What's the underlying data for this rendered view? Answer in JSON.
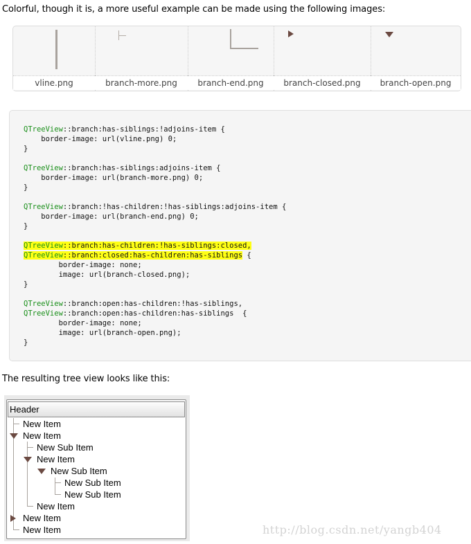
{
  "intro": "Colorful, though it is, a more useful example can be made using the following images:",
  "images": [
    {
      "file": "vline.png",
      "icon": "vertical-line"
    },
    {
      "file": "branch-more.png",
      "icon": "branch-more"
    },
    {
      "file": "branch-end.png",
      "icon": "branch-end"
    },
    {
      "file": "branch-closed.png",
      "icon": "closed-triangle"
    },
    {
      "file": "branch-open.png",
      "icon": "open-triangle"
    }
  ],
  "code": {
    "selector_kw": "QTreeView",
    "blocks": [
      {
        "sel1": "::branch:has-siblings:!adjoins-item",
        "tail1": " {",
        "body": [
          "    border-image: url(vline.png) 0;"
        ],
        "close": "}"
      },
      {
        "sel1": "::branch:has-siblings:adjoins-item",
        "tail1": " {",
        "body": [
          "    border-image: url(branch-more.png) 0;"
        ],
        "close": "}"
      },
      {
        "sel1": "::branch:!has-children:!has-siblings:adjoins-item",
        "tail1": " {",
        "body": [
          "    border-image: url(branch-end.png) 0;"
        ],
        "close": "}"
      },
      {
        "sel1": "::branch:has-children:!has-siblings:closed,",
        "sel2": "::branch:closed:has-children:has-siblings",
        "tail2": " {",
        "body": [
          "        border-image: none;",
          "        image: url(branch-closed.png);"
        ],
        "close": "}"
      },
      {
        "sel1": "::branch:open:has-children:!has-siblings,",
        "sel2": "::branch:open:has-children:has-siblings",
        "tail2": "  {",
        "body": [
          "        border-image: none;",
          "        image: url(branch-open.png);"
        ],
        "close": "}"
      }
    ]
  },
  "result_text": "The resulting tree view looks like this:",
  "tree": {
    "header": "Header",
    "items": [
      {
        "label": "New Item",
        "depth": 0,
        "state": "leaf"
      },
      {
        "label": "New Item",
        "depth": 0,
        "state": "open"
      },
      {
        "label": "New Sub Item",
        "depth": 1,
        "state": "leaf"
      },
      {
        "label": "New Item",
        "depth": 1,
        "state": "open"
      },
      {
        "label": "New Sub Item",
        "depth": 2,
        "state": "open"
      },
      {
        "label": "New Sub Item",
        "depth": 3,
        "state": "leaf"
      },
      {
        "label": "New Sub Item",
        "depth": 3,
        "state": "leaf"
      },
      {
        "label": "New Item",
        "depth": 1,
        "state": "leaf"
      },
      {
        "label": "New Item",
        "depth": 0,
        "state": "closed"
      },
      {
        "label": "New Item",
        "depth": 0,
        "state": "leaf"
      }
    ]
  },
  "watermark": "http://blog.csdn.net/yangb404",
  "colors": {
    "selector": "#1a8f1a",
    "highlight": "#ffff14",
    "branch_line": "#a8a29d",
    "arrow": "#6b4a42"
  }
}
